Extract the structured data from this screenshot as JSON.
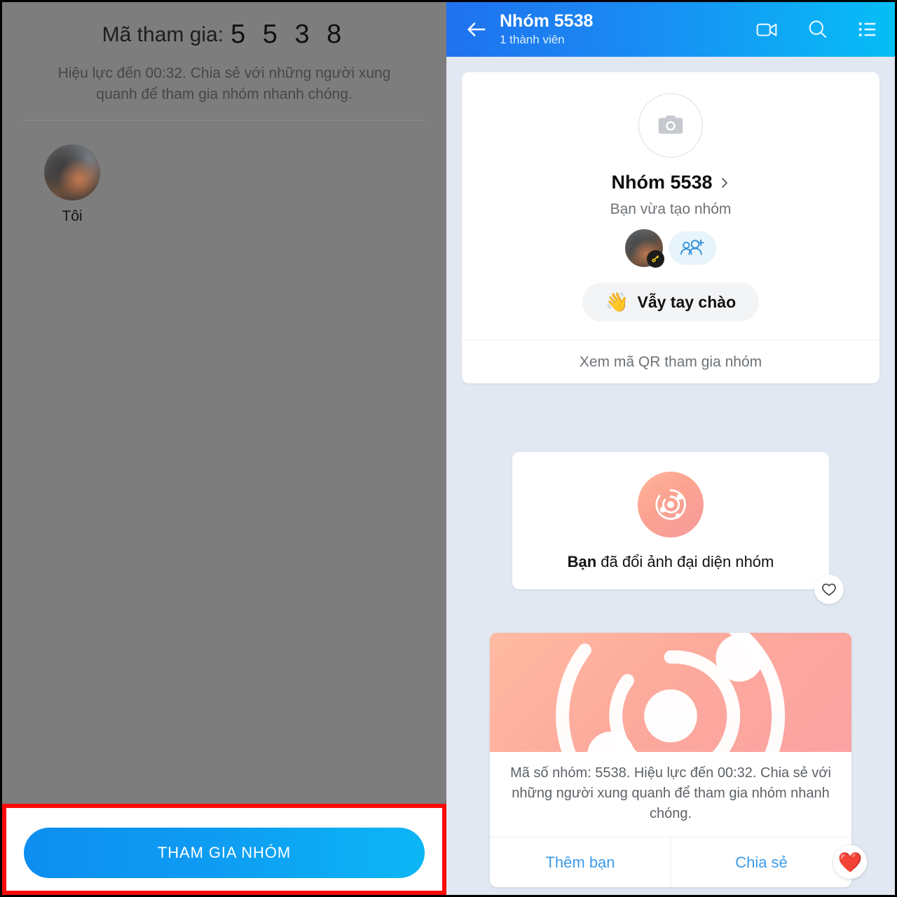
{
  "left_panel": {
    "join_code_label": "Mã tham gia:",
    "join_code_digits": "5 5 3 8",
    "subtitle": "Hiệu lực đến 00:32. Chia sẻ với những người xung quanh để tham gia nhóm nhanh chóng.",
    "members": [
      {
        "name": "Tôi"
      }
    ],
    "join_button_label": "THAM GIA NHÓM",
    "highlight_color": "#fb0a0a",
    "overlay_color": "#7d7d7d"
  },
  "right_panel": {
    "header": {
      "back_icon": "back-arrow-icon",
      "title": "Nhóm 5538",
      "subtitle": "1 thành viên",
      "actions": [
        {
          "icon": "video-call-icon"
        },
        {
          "icon": "search-icon"
        },
        {
          "icon": "list-menu-icon"
        }
      ],
      "gradient_from": "#1f72ee",
      "gradient_to": "#06bef6"
    },
    "info_card": {
      "avatar_icon": "camera-icon",
      "group_name": "Nhóm 5538",
      "chevron_icon": "chevron-right-icon",
      "created_text": "Bạn vừa tạo nhóm",
      "owner_badge_icon": "key-icon",
      "add_member_icon": "add-people-icon",
      "wave_emoji": "👋",
      "wave_label": "Vẫy tay chào",
      "qr_label": "Xem mã QR tham gia nhóm"
    },
    "event_card": {
      "icon": "orbit-icon",
      "text_bold": "Bạn",
      "text_rest": " đã đổi ảnh đại diện nhóm",
      "react_icon": "heart-outline-icon"
    },
    "share_card": {
      "banner_icon": "orbit-icon",
      "caption": "Mã số nhóm: 5538. Hiệu lực đến 00:32. Chia sẻ với những người xung quanh để tham gia nhóm nhanh chóng.",
      "actions": [
        {
          "label": "Thêm bạn"
        },
        {
          "label": "Chia sẻ"
        }
      ],
      "reaction_emoji": "❤️"
    },
    "background_color": "#e2e8f1"
  }
}
